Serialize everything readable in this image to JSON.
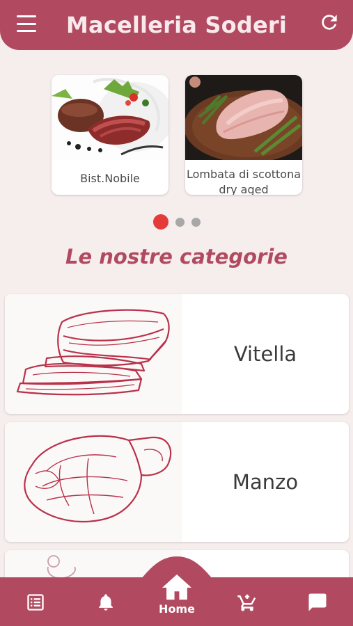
{
  "header": {
    "title": "Macelleria Soderi",
    "menu_icon": "hamburger-menu-icon",
    "refresh_icon": "refresh-icon"
  },
  "carousel": {
    "items": [
      {
        "label": "Bist.Nobile",
        "image": "sliced-steak-with-salad"
      },
      {
        "label": "Lombata di scottona dry aged",
        "image": "raw-loin-with-herbs"
      }
    ],
    "page_count": 3,
    "active_index": 0
  },
  "section_title": "Le nostre categorie",
  "categories": [
    {
      "name": "Vitella",
      "image": "sliced-meat-sketch"
    },
    {
      "name": "Manzo",
      "image": "steak-sketch"
    },
    {
      "name": "",
      "image": "partially-visible-sketch"
    }
  ],
  "bottom_nav": {
    "items": [
      {
        "icon": "list-icon"
      },
      {
        "icon": "bell-icon"
      },
      {
        "icon": "home-icon",
        "label": "Home",
        "active": true
      },
      {
        "icon": "cart-icon"
      },
      {
        "icon": "chat-icon"
      }
    ]
  },
  "colors": {
    "primary": "#b14a60",
    "background": "#f6eded",
    "active_dot": "#e53a3a"
  }
}
